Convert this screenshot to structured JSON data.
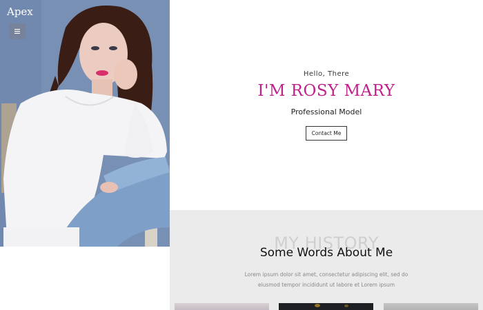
{
  "brand": {
    "name": "Apex"
  },
  "nav": {
    "menu_icon": "hamburger-icon"
  },
  "hero": {
    "greeting": "Hello, There",
    "name": "I'M ROSY MARY",
    "role": "Professional Model",
    "contact_label": "Contact Me",
    "name_color": "#c0208c"
  },
  "history": {
    "watermark": "MY HISTORY",
    "title": "Some Words About Me",
    "line1": "Lorem ipsum dolor sit amet, consectetur adipiscing elit, sed do",
    "line2": "eiusmod tempor incididunt ut labore et Lorem ipsum"
  }
}
